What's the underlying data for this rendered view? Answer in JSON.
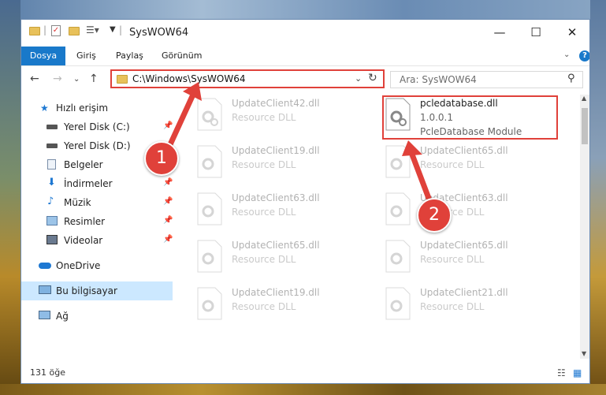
{
  "window": {
    "title": "SysWOW64",
    "controls": [
      "minimize",
      "maximize",
      "close"
    ]
  },
  "ribbon": {
    "tabs": [
      "Dosya",
      "Giriş",
      "Paylaş",
      "Görünüm"
    ],
    "help": "?"
  },
  "address": {
    "path": "C:\\Windows\\SysWOW64",
    "search_placeholder": "Ara: SysWOW64"
  },
  "sidebar": {
    "items": [
      {
        "label": "Hızlı erişim",
        "icon": "star-icon"
      },
      {
        "label": "Yerel Disk (C:)",
        "icon": "drive-icon",
        "pinned": true
      },
      {
        "label": "Yerel Disk (D:)",
        "icon": "drive-icon",
        "pinned": false
      },
      {
        "label": "Belgeler",
        "icon": "documents-icon",
        "pinned": true
      },
      {
        "label": "İndirmeler",
        "icon": "download-icon",
        "pinned": true
      },
      {
        "label": "Müzik",
        "icon": "music-icon",
        "pinned": true
      },
      {
        "label": "Resimler",
        "icon": "pictures-icon",
        "pinned": true
      },
      {
        "label": "Videolar",
        "icon": "videos-icon",
        "pinned": true
      },
      {
        "label": "OneDrive",
        "icon": "cloud-icon"
      },
      {
        "label": "Bu bilgisayar",
        "icon": "computer-icon",
        "selected": true
      },
      {
        "label": "Ağ",
        "icon": "network-icon"
      }
    ]
  },
  "files": [
    {
      "name": "UpdateClient42.dll",
      "type": "Resource DLL"
    },
    {
      "name": "pcledatabase.dll",
      "version": "1.0.0.1",
      "type": "PcleDatabase Module",
      "highlighted": true
    },
    {
      "name": "UpdateClient19.dll",
      "type": "Resource DLL"
    },
    {
      "name": "UpdateClient65.dll",
      "type": "Resource DLL"
    },
    {
      "name": "UpdateClient63.dll",
      "type": "Resource DLL"
    },
    {
      "name": "UpdateClient63.dll",
      "type": "Resource DLL"
    },
    {
      "name": "UpdateClient65.dll",
      "type": "Resource DLL"
    },
    {
      "name": "UpdateClient65.dll",
      "type": "Resource DLL"
    },
    {
      "name": "UpdateClient19.dll",
      "type": "Resource DLL"
    },
    {
      "name": "UpdateClient21.dll",
      "type": "Resource DLL"
    }
  ],
  "status": {
    "item_count": "131 öğe"
  },
  "annotations": {
    "step1": "1",
    "step2": "2",
    "color": "#e0413a"
  }
}
